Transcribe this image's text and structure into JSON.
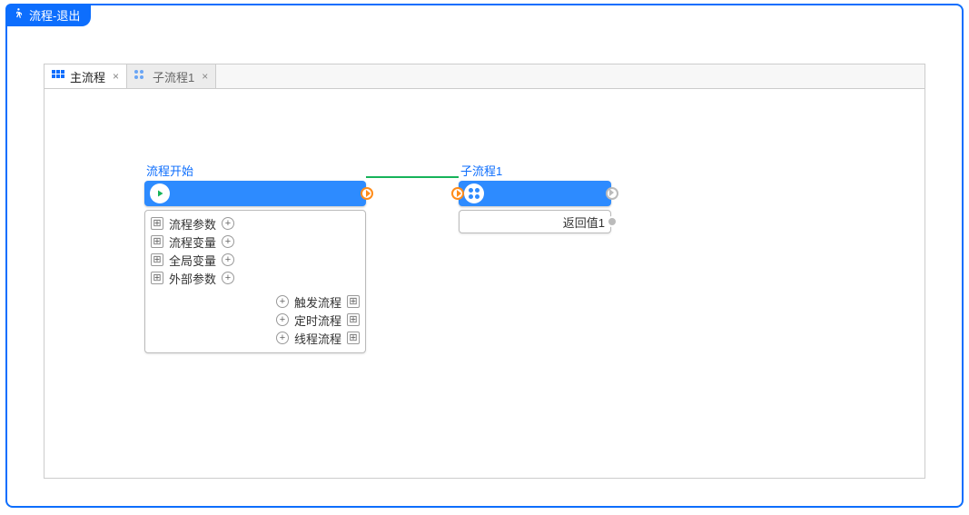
{
  "panel": {
    "title": "流程-退出"
  },
  "tabs": [
    {
      "label": "主流程",
      "active": true
    },
    {
      "label": "子流程1",
      "active": false
    }
  ],
  "start_node": {
    "title": "流程开始",
    "rows_left": [
      {
        "label": "流程参数"
      },
      {
        "label": "流程变量"
      },
      {
        "label": "全局变量"
      },
      {
        "label": "外部参数"
      }
    ],
    "rows_right": [
      {
        "label": "触发流程"
      },
      {
        "label": "定时流程"
      },
      {
        "label": "线程流程"
      }
    ]
  },
  "sub_node": {
    "title": "子流程1",
    "return_label": "返回值1"
  }
}
